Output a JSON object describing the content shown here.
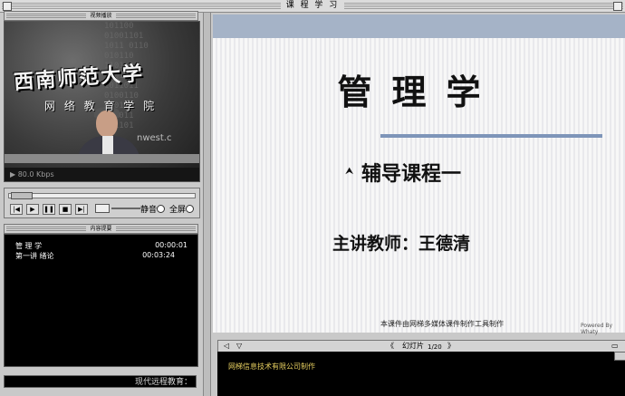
{
  "window": {
    "title": "课 程 学 习"
  },
  "video_panel": {
    "header": "视频播放",
    "logo_text": "西南师范大学",
    "logo_sub": "网 络 教 育 学 院",
    "watermark_url": "nwest.c",
    "bitrate": "80.0 Kbps"
  },
  "controls": {
    "mute_label": "静音",
    "fullscreen_label": "全屏"
  },
  "content_panel": {
    "header": "内容提要",
    "items": [
      {
        "label": "管 理 学",
        "time": "00:00:01"
      },
      {
        "label": "第一讲  绪论",
        "time": "00:03:24"
      }
    ],
    "bottom_text": "现代远程教育："
  },
  "slide": {
    "title": "管理学",
    "subtitle": "辅导课程一",
    "teacher": "主讲教师：王德清",
    "credit": "本课件由网梯多媒体课件制作工具制作",
    "powered": "Powered By Whaty"
  },
  "slide_nav": {
    "label": "幻灯片",
    "page": "1/20"
  },
  "note": {
    "text": "网梯信息技术有限公司制作"
  },
  "colors": {
    "slide_band": "#a5b3c7",
    "rule": "#7e95b9",
    "note_text": "#e8d060"
  }
}
